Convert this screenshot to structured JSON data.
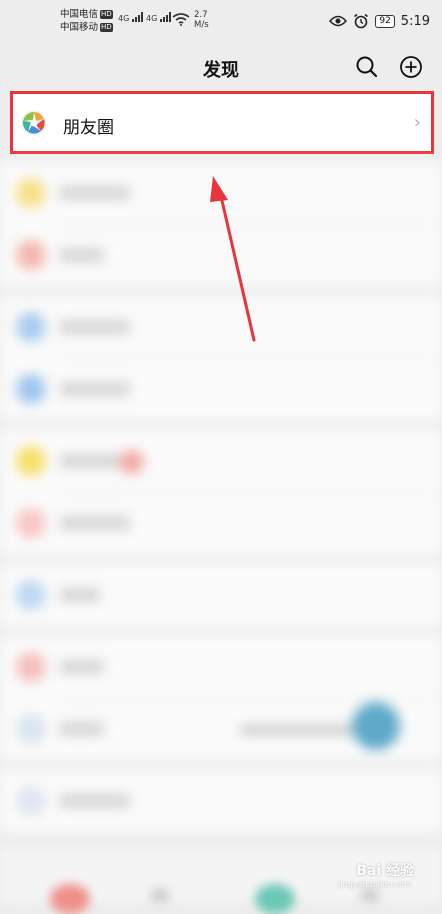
{
  "status_bar": {
    "carrier1": "中国电信",
    "carrier2": "中国移动",
    "hd": "HD",
    "network": "4G",
    "speed_value": "2.7",
    "speed_unit": "M/s",
    "battery": "92",
    "time": "5:19"
  },
  "header": {
    "title": "发现",
    "search_icon": "search-icon",
    "add_icon": "plus-circle-icon"
  },
  "moments": {
    "label": "朋友圈",
    "icon": "moments-aperture-icon",
    "highlight_color": "#e8353b"
  },
  "annotation": {
    "arrow_color": "#e8353b"
  },
  "watermark": {
    "text": "Bai 经验",
    "sub": "jingyan.baidu.com"
  },
  "colors": {
    "background": "#ededed",
    "row": "#ffffff",
    "accent": "#e8353b"
  }
}
